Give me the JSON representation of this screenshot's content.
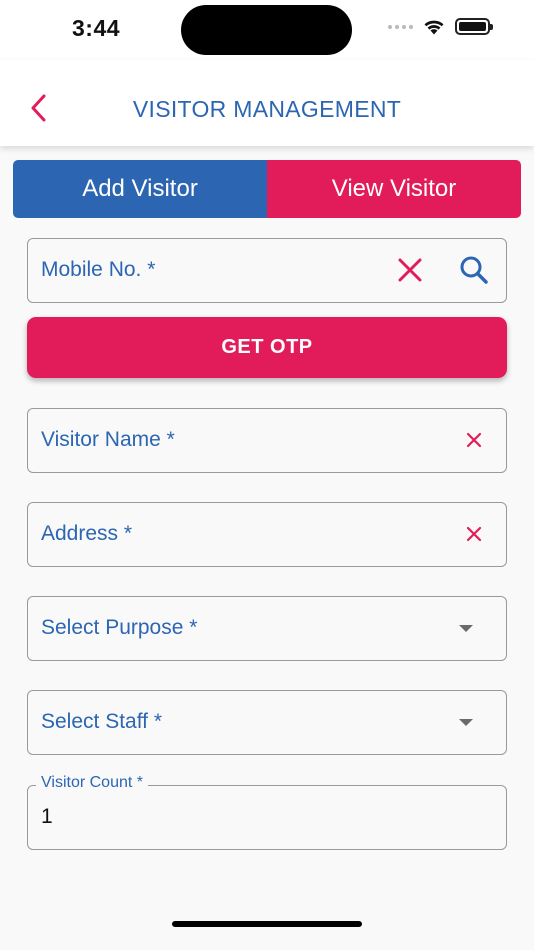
{
  "status_bar": {
    "time": "3:44",
    "icons": [
      "signal-icon",
      "wifi-icon",
      "battery-icon"
    ]
  },
  "header": {
    "title": "VISITOR MANAGEMENT",
    "back_icon": "chevron-left-icon"
  },
  "tabs": [
    {
      "label": "Add Visitor",
      "color": "#2c66b2",
      "active": true
    },
    {
      "label": "View Visitor",
      "color": "#e21c5b",
      "active": false
    }
  ],
  "form": {
    "mobile": {
      "label": "Mobile No. *",
      "clear_icon": "close-icon",
      "search_icon": "search-icon"
    },
    "otp_button": "GET OTP",
    "visitor_name": {
      "label": "Visitor Name *",
      "clear_icon": "close-icon"
    },
    "address": {
      "label": "Address *",
      "clear_icon": "close-icon"
    },
    "purpose": {
      "label": "Select Purpose *",
      "dropdown_icon": "caret-down-icon"
    },
    "staff": {
      "label": "Select Staff *",
      "dropdown_icon": "caret-down-icon"
    },
    "visitor_count": {
      "label": "Visitor Count *",
      "value": "1"
    }
  },
  "colors": {
    "primary": "#2c66b2",
    "accent": "#e21c5b",
    "background": "#f9f9f9"
  }
}
